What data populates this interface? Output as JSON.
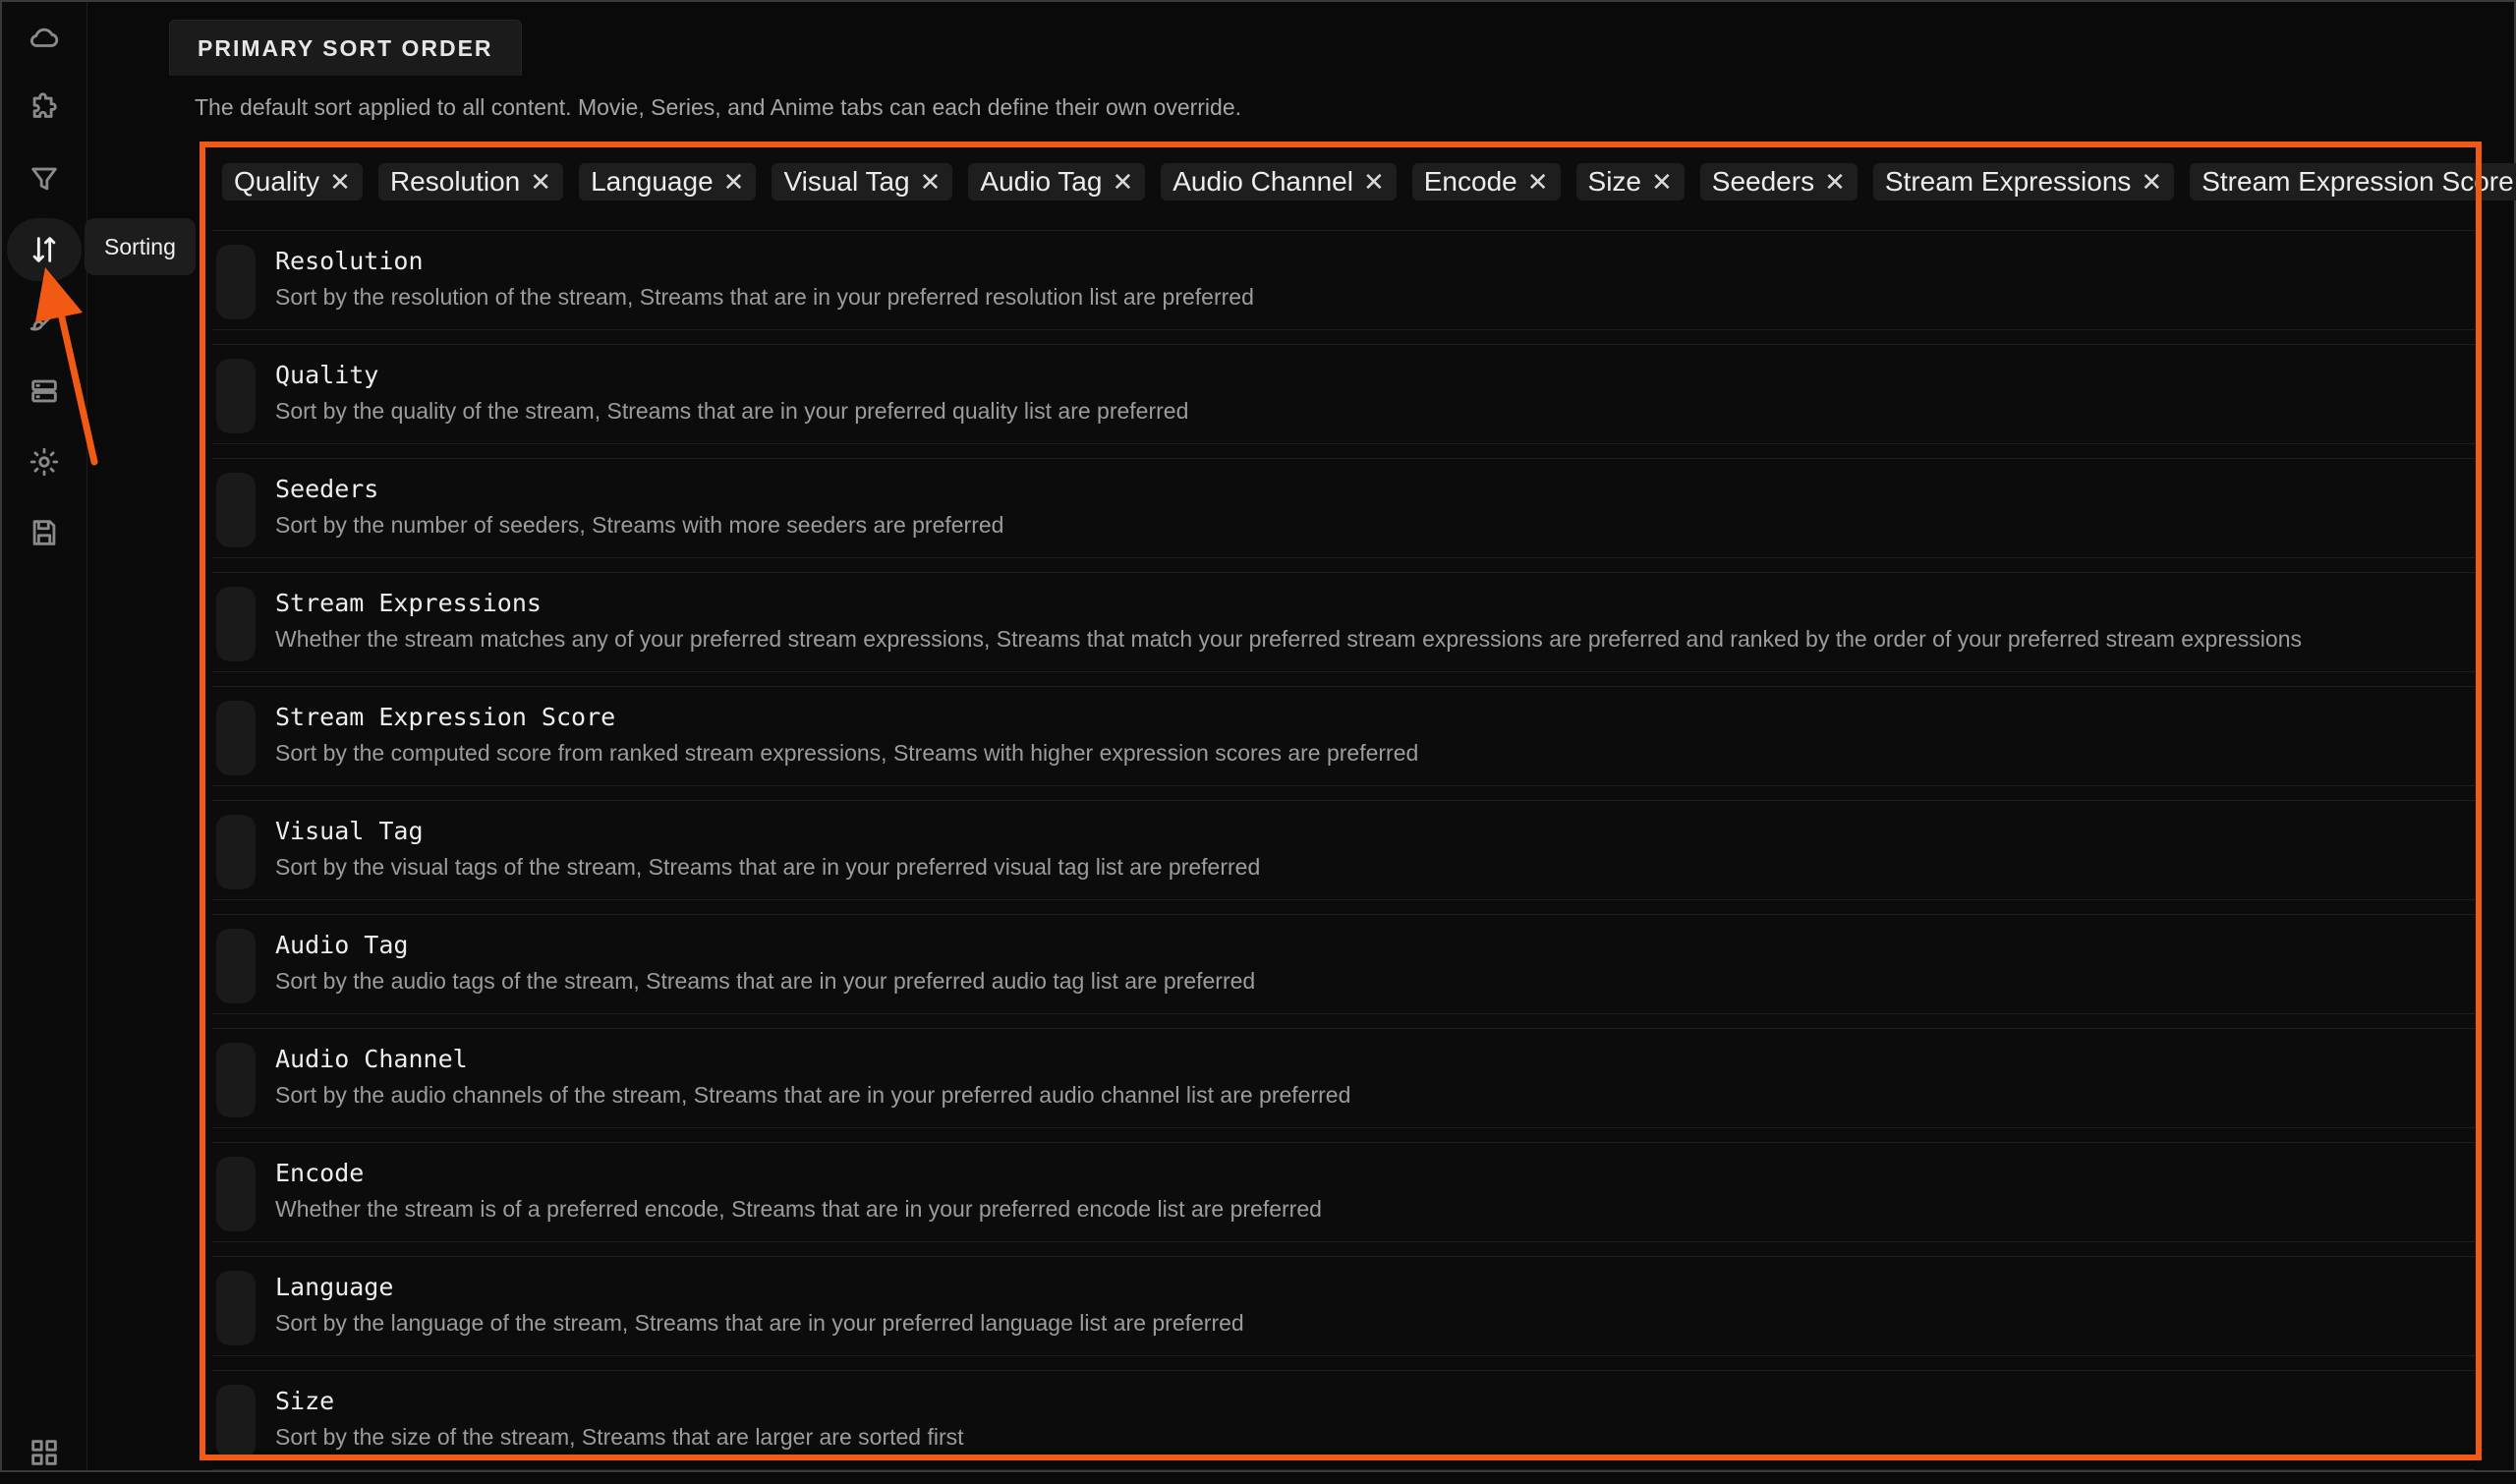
{
  "sidebar": {
    "items": [
      {
        "name": "cloud-icon"
      },
      {
        "name": "puzzle-icon"
      },
      {
        "name": "filter-icon"
      },
      {
        "name": "sort-icon",
        "active": true
      },
      {
        "name": "brush-icon"
      },
      {
        "name": "server-icon"
      },
      {
        "name": "gear-icon"
      },
      {
        "name": "save-icon"
      },
      {
        "name": "grid-icon"
      }
    ],
    "tooltip": "Sorting"
  },
  "section": {
    "title": "PRIMARY SORT ORDER",
    "description": "The default sort applied to all content. Movie, Series, and Anime tabs can each define their own override."
  },
  "chips": [
    "Quality",
    "Resolution",
    "Language",
    "Visual Tag",
    "Audio Tag",
    "Audio Channel",
    "Encode",
    "Size",
    "Seeders",
    "Stream Expressions",
    "Stream Expression Score"
  ],
  "chip_remove_glyph": "✕",
  "rows": [
    {
      "title": "Resolution",
      "desc": "Sort by the resolution of the stream, Streams that are in your preferred resolution list are preferred"
    },
    {
      "title": "Quality",
      "desc": "Sort by the quality of the stream, Streams that are in your preferred quality list are preferred"
    },
    {
      "title": "Seeders",
      "desc": "Sort by the number of seeders, Streams with more seeders are preferred"
    },
    {
      "title": "Stream Expressions",
      "desc": "Whether the stream matches any of your preferred stream expressions, Streams that match your preferred stream expressions are preferred and ranked by the order of your preferred stream expressions"
    },
    {
      "title": "Stream Expression Score",
      "desc": "Sort by the computed score from ranked stream expressions, Streams with higher expression scores are preferred"
    },
    {
      "title": "Visual Tag",
      "desc": "Sort by the visual tags of the stream, Streams that are in your preferred visual tag list are preferred"
    },
    {
      "title": "Audio Tag",
      "desc": "Sort by the audio tags of the stream, Streams that are in your preferred audio tag list are preferred"
    },
    {
      "title": "Audio Channel",
      "desc": "Sort by the audio channels of the stream, Streams that are in your preferred audio channel list are preferred"
    },
    {
      "title": "Encode",
      "desc": "Whether the stream is of a preferred encode, Streams that are in your preferred encode list are preferred"
    },
    {
      "title": "Language",
      "desc": "Sort by the language of the stream, Streams that are in your preferred language list are preferred"
    },
    {
      "title": "Size",
      "desc": "Sort by the size of the stream, Streams that are larger are sorted first"
    }
  ],
  "colors": {
    "highlight": "#f25a14",
    "background": "#0a0a0a"
  }
}
